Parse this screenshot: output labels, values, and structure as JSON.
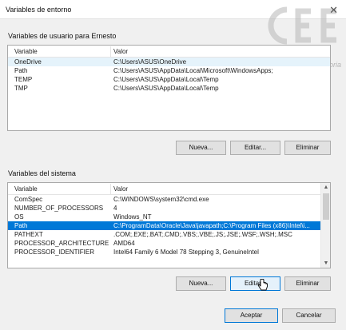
{
  "window": {
    "title": "Variables de entorno",
    "close_glyph": "✕",
    "watermark_text": "tutoria",
    "watermark_icon": "cee-logo"
  },
  "user_vars": {
    "label": "Variables de usuario para Ernesto",
    "columns": [
      "Variable",
      "Valor"
    ],
    "rows": [
      {
        "variable": "OneDrive",
        "valor": "C:\\Users\\ASUS\\OneDrive"
      },
      {
        "variable": "Path",
        "valor": "C:\\Users\\ASUS\\AppData\\Local\\Microsoft\\WindowsApps;"
      },
      {
        "variable": "TEMP",
        "valor": "C:\\Users\\ASUS\\AppData\\Local\\Temp"
      },
      {
        "variable": "TMP",
        "valor": "C:\\Users\\ASUS\\AppData\\Local\\Temp"
      }
    ],
    "buttons": {
      "new": "Nueva...",
      "edit": "Editar...",
      "delete": "Eliminar"
    }
  },
  "system_vars": {
    "label": "Variables del sistema",
    "columns": [
      "Variable",
      "Valor"
    ],
    "rows": [
      {
        "variable": "ComSpec",
        "valor": "C:\\WINDOWS\\system32\\cmd.exe"
      },
      {
        "variable": "NUMBER_OF_PROCESSORS",
        "valor": "4"
      },
      {
        "variable": "OS",
        "valor": "Windows_NT"
      },
      {
        "variable": "Path",
        "valor": "C:\\ProgramData\\Oracle\\Java\\javapath;C:\\Program Files (x86)\\Intel\\i..."
      },
      {
        "variable": "PATHEXT",
        "valor": ".COM;.EXE;.BAT;.CMD;.VBS;.VBE;.JS;.JSE;.WSF;.WSH;.MSC"
      },
      {
        "variable": "PROCESSOR_ARCHITECTURE",
        "valor": "AMD64"
      },
      {
        "variable": "PROCESSOR_IDENTIFIER",
        "valor": "Intel64 Family 6 Model 78 Stepping 3, GenuineIntel"
      }
    ],
    "selected_row": "Path",
    "buttons": {
      "new": "Nueva...",
      "edit": "Editar...",
      "delete": "Eliminar"
    },
    "scroll_up": "▲",
    "scroll_down": "▼"
  },
  "footer": {
    "accept": "Aceptar",
    "cancel": "Cancelar"
  },
  "colors": {
    "selection": "#0078d7",
    "accent_border": "#0078d7"
  }
}
